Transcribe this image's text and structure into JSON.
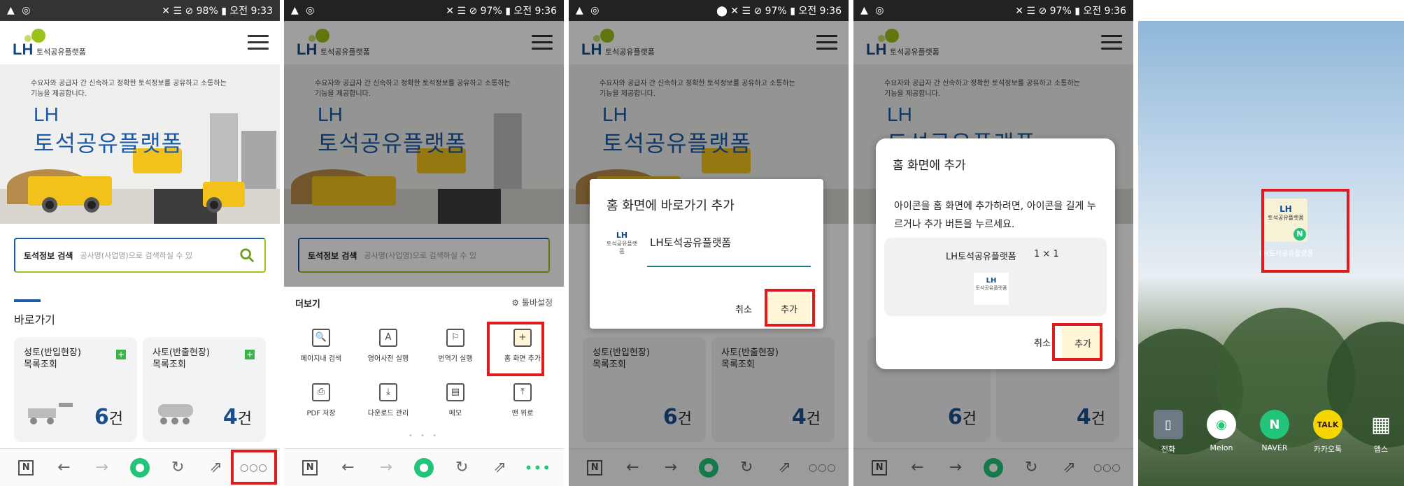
{
  "status": [
    {
      "left": "▲ ◎",
      "right": "✕ ☰ ⊘ 98% ▮ 오전 9:33"
    },
    {
      "left": "▲ ◎",
      "right": "✕ ☰ ⊘ 97% ▮ 오전 9:36"
    },
    {
      "left": "▲ ◎",
      "right": "⬤ ✕ ☰ ⊘ 97% ▮ 오전 9:36"
    },
    {
      "left": "▲ ◎",
      "right": "✕ ☰ ⊘ 97% ▮ 오전 9:36"
    },
    {
      "left": "▲ ◎",
      "right": "✕ ☰ ⊘ 96% ▮ 오전 9:36"
    }
  ],
  "header": {
    "lh": "LH",
    "platform": "토석공유플랫폼"
  },
  "hero": {
    "desc": "수요자와 공급자 간 신속하고 정확한 토석정보를 공유하고 소통하는 기능을 제공합니다.",
    "title1": "LH",
    "title2": "토석공유플랫폼"
  },
  "search": {
    "label": "토석정보 검색",
    "placeholder": "공사명(사업명)으로 검색하실 수 있"
  },
  "quick": {
    "title": "바로가기",
    "cards": [
      {
        "title_line1": "성토(반입현장)",
        "title_line2": "목록조회",
        "count": "6",
        "unit": "건"
      },
      {
        "title_line1": "사토(반출현장)",
        "title_line2": "목록조회",
        "count": "4",
        "unit": "건"
      }
    ]
  },
  "nav": {
    "n": "N",
    "back": "←",
    "forward": "→",
    "refresh": "↻",
    "share": "⇗",
    "more": "○○○",
    "more_active": "•••"
  },
  "more_sheet": {
    "title": "더보기",
    "settings": "⚙ 툴바설정",
    "tools": [
      {
        "icon": "🔍",
        "label": "페이지내 검색"
      },
      {
        "icon": "A",
        "label": "영어사전 실행"
      },
      {
        "icon": "⚐",
        "label": "번역기 실행"
      },
      {
        "icon": "+",
        "label": "홈 화면 추가"
      },
      {
        "icon": "⎙",
        "label": "PDF 저장"
      },
      {
        "icon": "⤓",
        "label": "다운로드 관리"
      },
      {
        "icon": "▤",
        "label": "메모"
      },
      {
        "icon": "⤒",
        "label": "맨 위로"
      }
    ],
    "dots": "• • •"
  },
  "shortcut_dialog": {
    "title": "홈 화면에 바로가기 추가",
    "name": "LH토석공유플랫폼",
    "icon_label": "토석공유플랫폼",
    "cancel": "취소",
    "add": "추가"
  },
  "widget_dialog": {
    "title": "홈 화면에 추가",
    "body": "아이콘을 홈 화면에 추가하려면, 아이콘을 길게 누르거나 추가 버튼을 누르세요.",
    "name": "LH토석공유플랫폼",
    "size": "1 × 1",
    "icon_label": "토석공유플랫폼",
    "cancel": "취소",
    "add": "추가"
  },
  "home": {
    "lh_icon_label": "LH토석공유플랫폼",
    "lh_icon_text": "토석공유플랫폼",
    "badge": "N",
    "apps": [
      {
        "label": "전화",
        "glyph": "▯",
        "color": "#6d7a86"
      },
      {
        "label": "Melon",
        "glyph": "◉",
        "color": "#ffffff"
      },
      {
        "label": "NAVER",
        "glyph": "N",
        "color": "#22c47a"
      },
      {
        "label": "카카오톡",
        "glyph": "TALK",
        "color": "#f6d600"
      },
      {
        "label": "앱스",
        "glyph": "▦",
        "color": "#9aa4ad"
      }
    ]
  }
}
